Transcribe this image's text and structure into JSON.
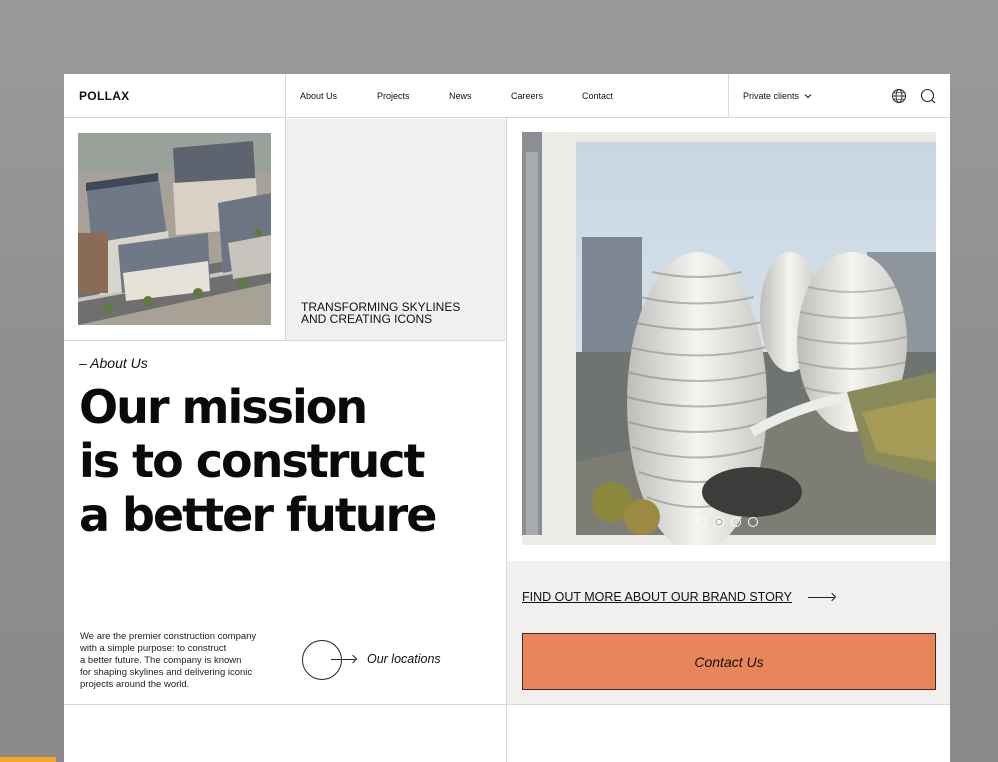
{
  "brand": {
    "logo": "POLLAX"
  },
  "nav": {
    "items": [
      "About Us",
      "Projects",
      "News",
      "Careers",
      "Contact"
    ],
    "private_clients": "Private clients"
  },
  "icons": {
    "language": "globe-icon",
    "search": "search-icon",
    "dropdown": "chevron-down-icon"
  },
  "hero": {
    "tagline_line1": "TRANSFORMING SKYLINES",
    "tagline_line2": "AND CREATING ICONS",
    "section_label": "– About Us",
    "headline_line1": "Our mission",
    "headline_line2": "is to construct",
    "headline_line3": "a better future",
    "description_lines": [
      "We are the premier construction company",
      "with a simple purpose: to construct",
      "a better future. The company is known",
      "for shaping skylines and delivering iconic",
      "projects around the world."
    ],
    "locations_label": "Our locations"
  },
  "slider": {
    "dot_count": 4,
    "active_index": 1
  },
  "cta": {
    "brand_story": "FIND OUT MORE ABOUT OUR BRAND STORY",
    "contact": "Contact Us"
  },
  "colors": {
    "accent": "#e8855b",
    "panel": "#f1f0ee",
    "text": "#111111",
    "border": "#d8d8d8"
  }
}
